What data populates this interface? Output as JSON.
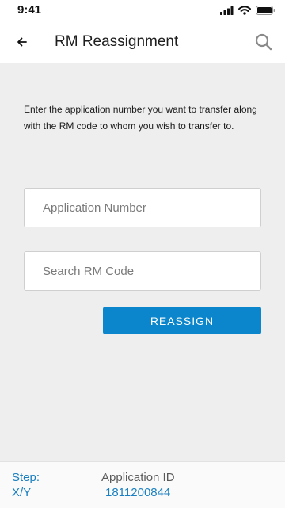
{
  "status_bar": {
    "time": "9:41",
    "icons": [
      "signal-icon",
      "wifi-icon",
      "battery-icon"
    ]
  },
  "header": {
    "title": "RM Reassignment",
    "back_icon": "back-arrow-icon",
    "search_icon": "search-icon"
  },
  "form": {
    "instruction": "Enter the application number you want to transfer along with the RM code to whom you wish to transfer to.",
    "application_number": {
      "placeholder": "Application Number",
      "value": ""
    },
    "rm_code": {
      "placeholder": "Search RM Code",
      "value": ""
    },
    "reassign_label": "REASSIGN"
  },
  "footer": {
    "step_label": "Step:",
    "step_value": "X/Y",
    "application_id_label": "Application ID",
    "application_id_value": "1811200844"
  },
  "colors": {
    "accent": "#0b86cc",
    "link_blue": "#1a7fc0",
    "page_background": "#eeeeee",
    "header_background": "#ffffff"
  }
}
